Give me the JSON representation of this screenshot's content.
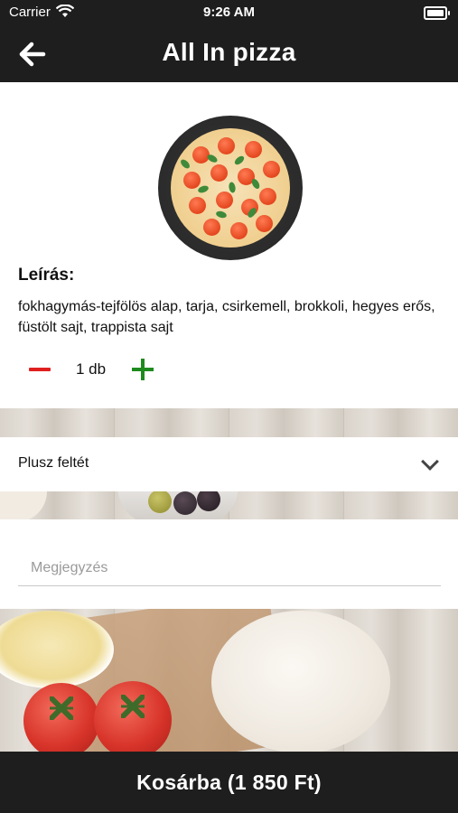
{
  "status_bar": {
    "carrier": "Carrier",
    "time": "9:26 AM"
  },
  "header": {
    "title": "All In pizza",
    "back_icon": "arrow-left-icon"
  },
  "product": {
    "description_title": "Leírás:",
    "description": "fokhagymás-tejfölös alap, tarja, csirkemell, brokkoli, hegyes erős, füstölt sajt, trappista sajt",
    "quantity_label": "1 db"
  },
  "extras": {
    "label": "Plusz feltét"
  },
  "note": {
    "placeholder": "Megjegyzés"
  },
  "cart": {
    "button_label": "Kosárba (1 850 Ft)"
  },
  "colors": {
    "bar_background": "#1e1e1e",
    "minus": "#e02020",
    "plus": "#1e8a1e"
  }
}
